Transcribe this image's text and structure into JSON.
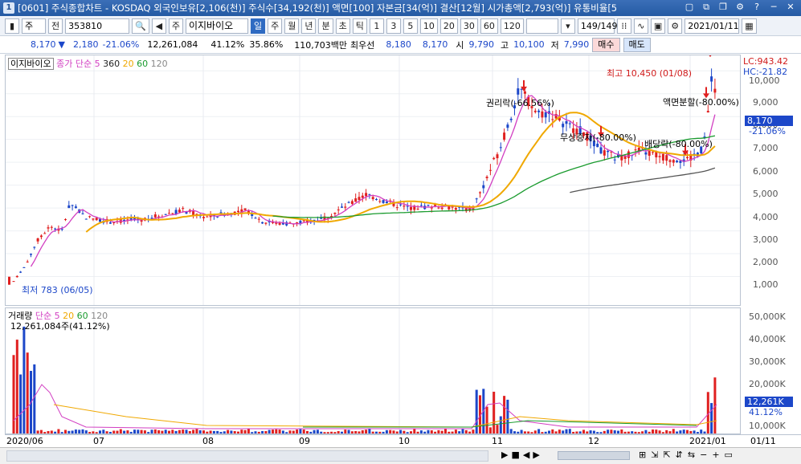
{
  "window": {
    "app_icon": "1",
    "title": "[0601] 주식종합차트 - KOSDAQ 외국인보유[2,106(천)] 주식수[34,192(천)] 액면[100] 자본금[34(억)] 결산[12월] 시가총액[2,793(억)] 유통비율[5",
    "buttons": [
      "window-icon",
      "link-icon",
      "restore-icon",
      "settings-icon",
      "help-icon",
      "minimize-icon",
      "close-icon"
    ]
  },
  "toolbar": {
    "period_select": "주",
    "jeon_label": "전",
    "code_value": "353810",
    "stock_name_prefix": "주",
    "stock_name": "이지바이오",
    "period_tabs": [
      "일",
      "주",
      "월",
      "년",
      "분",
      "초",
      "틱"
    ],
    "active_period": "일",
    "intervals": [
      "1",
      "3",
      "5",
      "10",
      "20",
      "30",
      "60",
      "120"
    ],
    "page_counter": "149/149",
    "date_value": "2021/01/11"
  },
  "quote": {
    "price": "8,170",
    "change_arrow": "▼",
    "change": "2,180",
    "change_rate": "-21.06%",
    "volume": "12,261,084",
    "turnover_rate": "41.12%",
    "ratio2": "35.86%",
    "trade_amount": "110,703백만",
    "preferred_label": "최우선",
    "bid": "8,180",
    "ask": "8,170",
    "open_label": "시",
    "open": "9,790",
    "high_label": "고",
    "high": "10,100",
    "low_label": "저",
    "low": "7,990",
    "buy_label": "매수",
    "sell_label": "매도"
  },
  "price_panel": {
    "stock_tag": "이지바이오",
    "legend_label": "종가 단순",
    "ma_values": [
      "5",
      "360",
      "20",
      "60",
      "120"
    ],
    "y_ticks": [
      "10,000",
      "9,000",
      "8,000",
      "7,000",
      "6,000",
      "5,000",
      "4,000",
      "3,000",
      "2,000",
      "1,000"
    ],
    "lc_label": "LC:943.42",
    "hc_label": "HC:-21.82",
    "current_price_tag": "8,170",
    "current_change_tag": "-21.06%",
    "annotations": {
      "max": "최고 10,450 (01/08)",
      "min": "최저 783 (06/05)",
      "rights_ex": "권리락(-66.56%)",
      "bonus_ex": "무상증자(-80.00%)",
      "dividend_ex": "배당락(-80.00%)",
      "split": "액면분할(-80.00%)"
    }
  },
  "volume_panel": {
    "legend_label": "거래량",
    "legend_ma_label": "단순",
    "ma_values": [
      "5",
      "20",
      "60",
      "120"
    ],
    "current_volume_text": "12,261,084주(41.12%)",
    "y_ticks": [
      "50,000K",
      "40,000K",
      "30,000K",
      "20,000K",
      "10,000K"
    ],
    "current_volume_tag": "12,261K",
    "current_rate_tag": "41.12%"
  },
  "x_axis": {
    "labels": [
      "2020/06",
      "07",
      "08",
      "09",
      "10",
      "11",
      "12",
      "2021/01",
      "01/11"
    ]
  },
  "colors": {
    "up": "#e02020",
    "down": "#1c47c9",
    "ma5": "#d23fc2",
    "ma20": "#f0a800",
    "ma60": "#1a9b2e",
    "ma120": "#555555",
    "title_bar": "#245aa3"
  },
  "chart_data": {
    "type": "candlestick",
    "x": [
      "2020/06",
      "07",
      "08",
      "09",
      "10",
      "11",
      "12",
      "2021/01"
    ],
    "close_approx": [
      2800,
      3500,
      3600,
      3500,
      3900,
      7800,
      6200,
      8170
    ],
    "high": 10450,
    "low": 783,
    "ylim": [
      0,
      10500
    ],
    "volume_ylim": [
      0,
      52000000
    ]
  }
}
